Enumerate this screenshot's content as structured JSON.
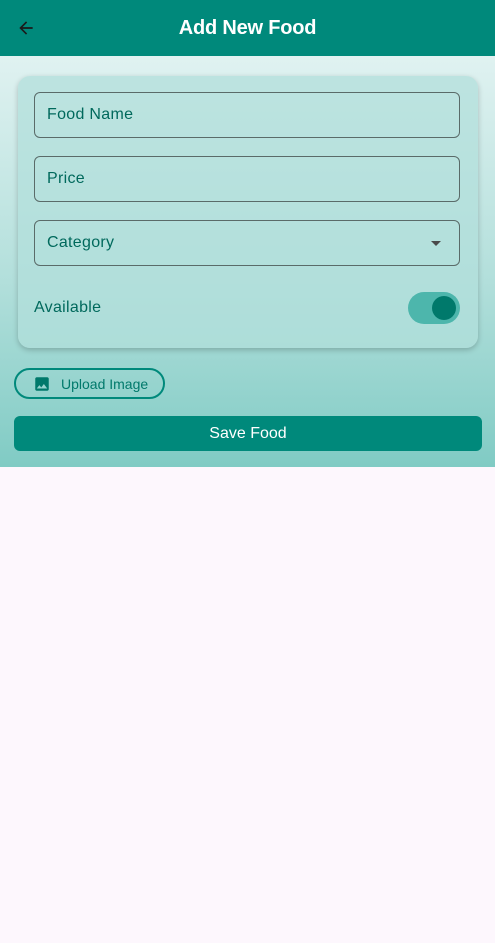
{
  "appbar": {
    "title": "Add New Food",
    "back_icon": "arrow-back-icon"
  },
  "form": {
    "food_name_label": "Food Name",
    "price_label": "Price",
    "category_label": "Category",
    "category_icon": "dropdown-arrow-icon",
    "available_label": "Available",
    "available_on": true
  },
  "actions": {
    "upload_label": "Upload Image",
    "upload_icon": "image-icon",
    "save_label": "Save Food"
  },
  "colors": {
    "primary": "#00897b",
    "primary_dark": "#00796b",
    "label": "#00695c",
    "background": "#fdf7fd"
  }
}
